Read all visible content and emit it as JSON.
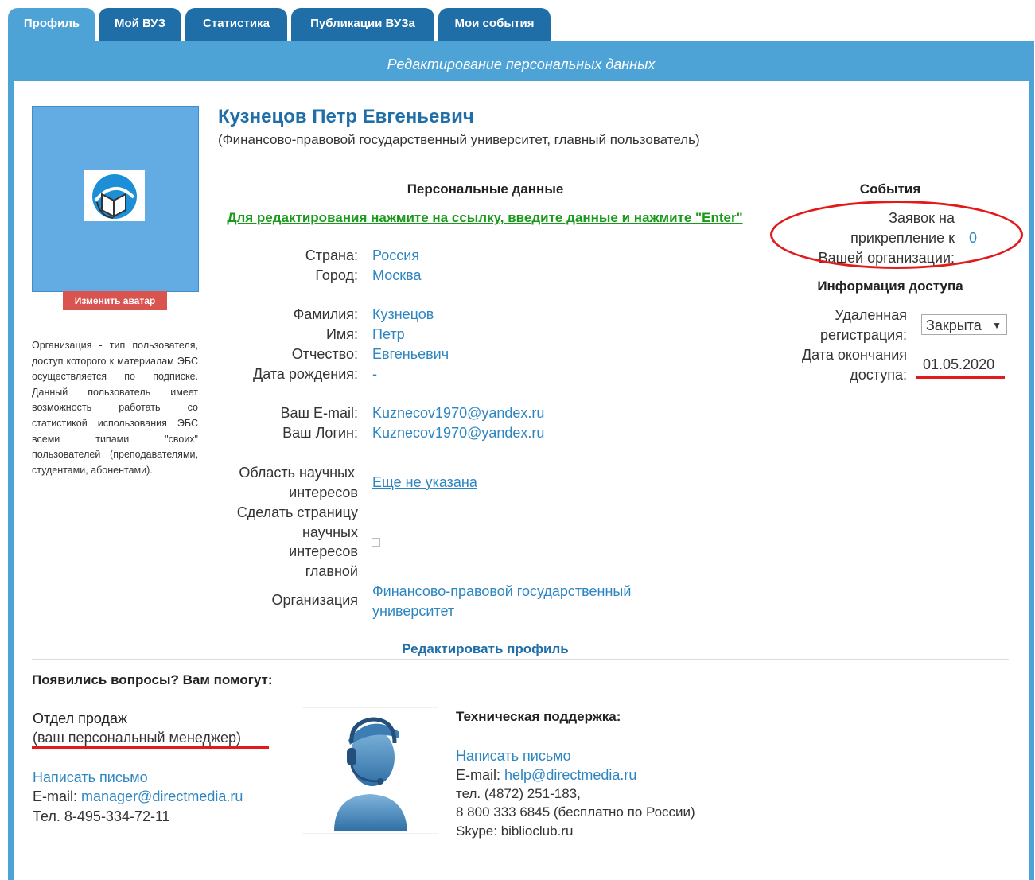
{
  "tabs": [
    {
      "label": "Профиль",
      "active": true
    },
    {
      "label": "Мой ВУЗ"
    },
    {
      "label": "Статистика"
    },
    {
      "label": "Публикации ВУЗа"
    },
    {
      "label": "Мои события"
    }
  ],
  "banner_title": "Редактирование персональных данных",
  "avatar": {
    "change_label": "Изменить аватар"
  },
  "org_note": "Организация - тип пользователя, доступ которого к материалам ЭБС осуществляется по подписке. Данный пользователь имеет возможность работать со статистикой использования ЭБС всеми типами \"своих\" пользователей (преподавателями, студентами, абонентами).",
  "profile": {
    "name": "Кузнецов Петр Евгеньевич",
    "subtitle": "(Финансово-правовой государственный университет, главный пользователь)"
  },
  "personal": {
    "heading": "Персональные данные",
    "edit_hint": "Для редактирования нажмите на ссылку, введите данные и нажмите \"Enter\"",
    "country_label": "Страна:",
    "country": "Россия",
    "city_label": "Город:",
    "city": "Москва",
    "lastname_label": "Фамилия:",
    "lastname": "Кузнецов",
    "firstname_label": "Имя:",
    "firstname": "Петр",
    "patronymic_label": "Отчество:",
    "patronymic": "Евгеньевич",
    "birthdate_label": "Дата рождения:",
    "birthdate": "-",
    "email_label": "Ваш E-mail:",
    "email": "Kuznecov1970@yandex.ru",
    "login_label": "Ваш Логин:",
    "login": "Kuznecov1970@yandex.ru",
    "interests_label_1": "Область научных",
    "interests_label_2": "интересов",
    "interests_value": "Еще не указана",
    "main_page_label_1": "Сделать страницу",
    "main_page_label_2": "научных",
    "main_page_label_3": "интересов",
    "main_page_label_4": "главной",
    "main_page_checked": false,
    "org_label": "Организация",
    "org_value_1": "Финансово-правовой государственный",
    "org_value_2": "университет",
    "edit_profile": "Редактировать профиль"
  },
  "events": {
    "heading": "События",
    "requests_line1": "Заявок на",
    "requests_line2": "прикрепление к",
    "requests_line3": "Вашей организации:",
    "requests_count": "0"
  },
  "access": {
    "heading": "Информация доступа",
    "remote_label_1": "Удаленная",
    "remote_label_2": "регистрация:",
    "remote_value": "Закрыта",
    "end_label_1": "Дата окончания",
    "end_label_2": "доступа:",
    "end_value": "01.05.2020"
  },
  "help": {
    "heading": "Появились вопросы? Вам помогут:",
    "sales_title": "Отдел продаж",
    "sales_sub": "(ваш персональный менеджер)",
    "sales_write": "Написать письмо",
    "sales_email_label": "E-mail: ",
    "sales_email": "manager@directmedia.ru",
    "sales_phone": "Тел. 8-495-334-72-11",
    "tech_title": "Техническая поддержка:",
    "tech_write": "Написать письмо",
    "tech_email_label": "E-mail: ",
    "tech_email": "help@directmedia.ru",
    "tech_phone": "тел. (4872) 251-183,",
    "tech_free": "8 800 333 6845 (бесплатно по России)",
    "tech_skype": "Skype: biblioclub.ru"
  },
  "colors": {
    "tab": "#1f6ea8",
    "tab_active": "#4ea3d6",
    "link": "#2e86c1",
    "green": "#1a9a1a",
    "red": "#e21a1a"
  }
}
